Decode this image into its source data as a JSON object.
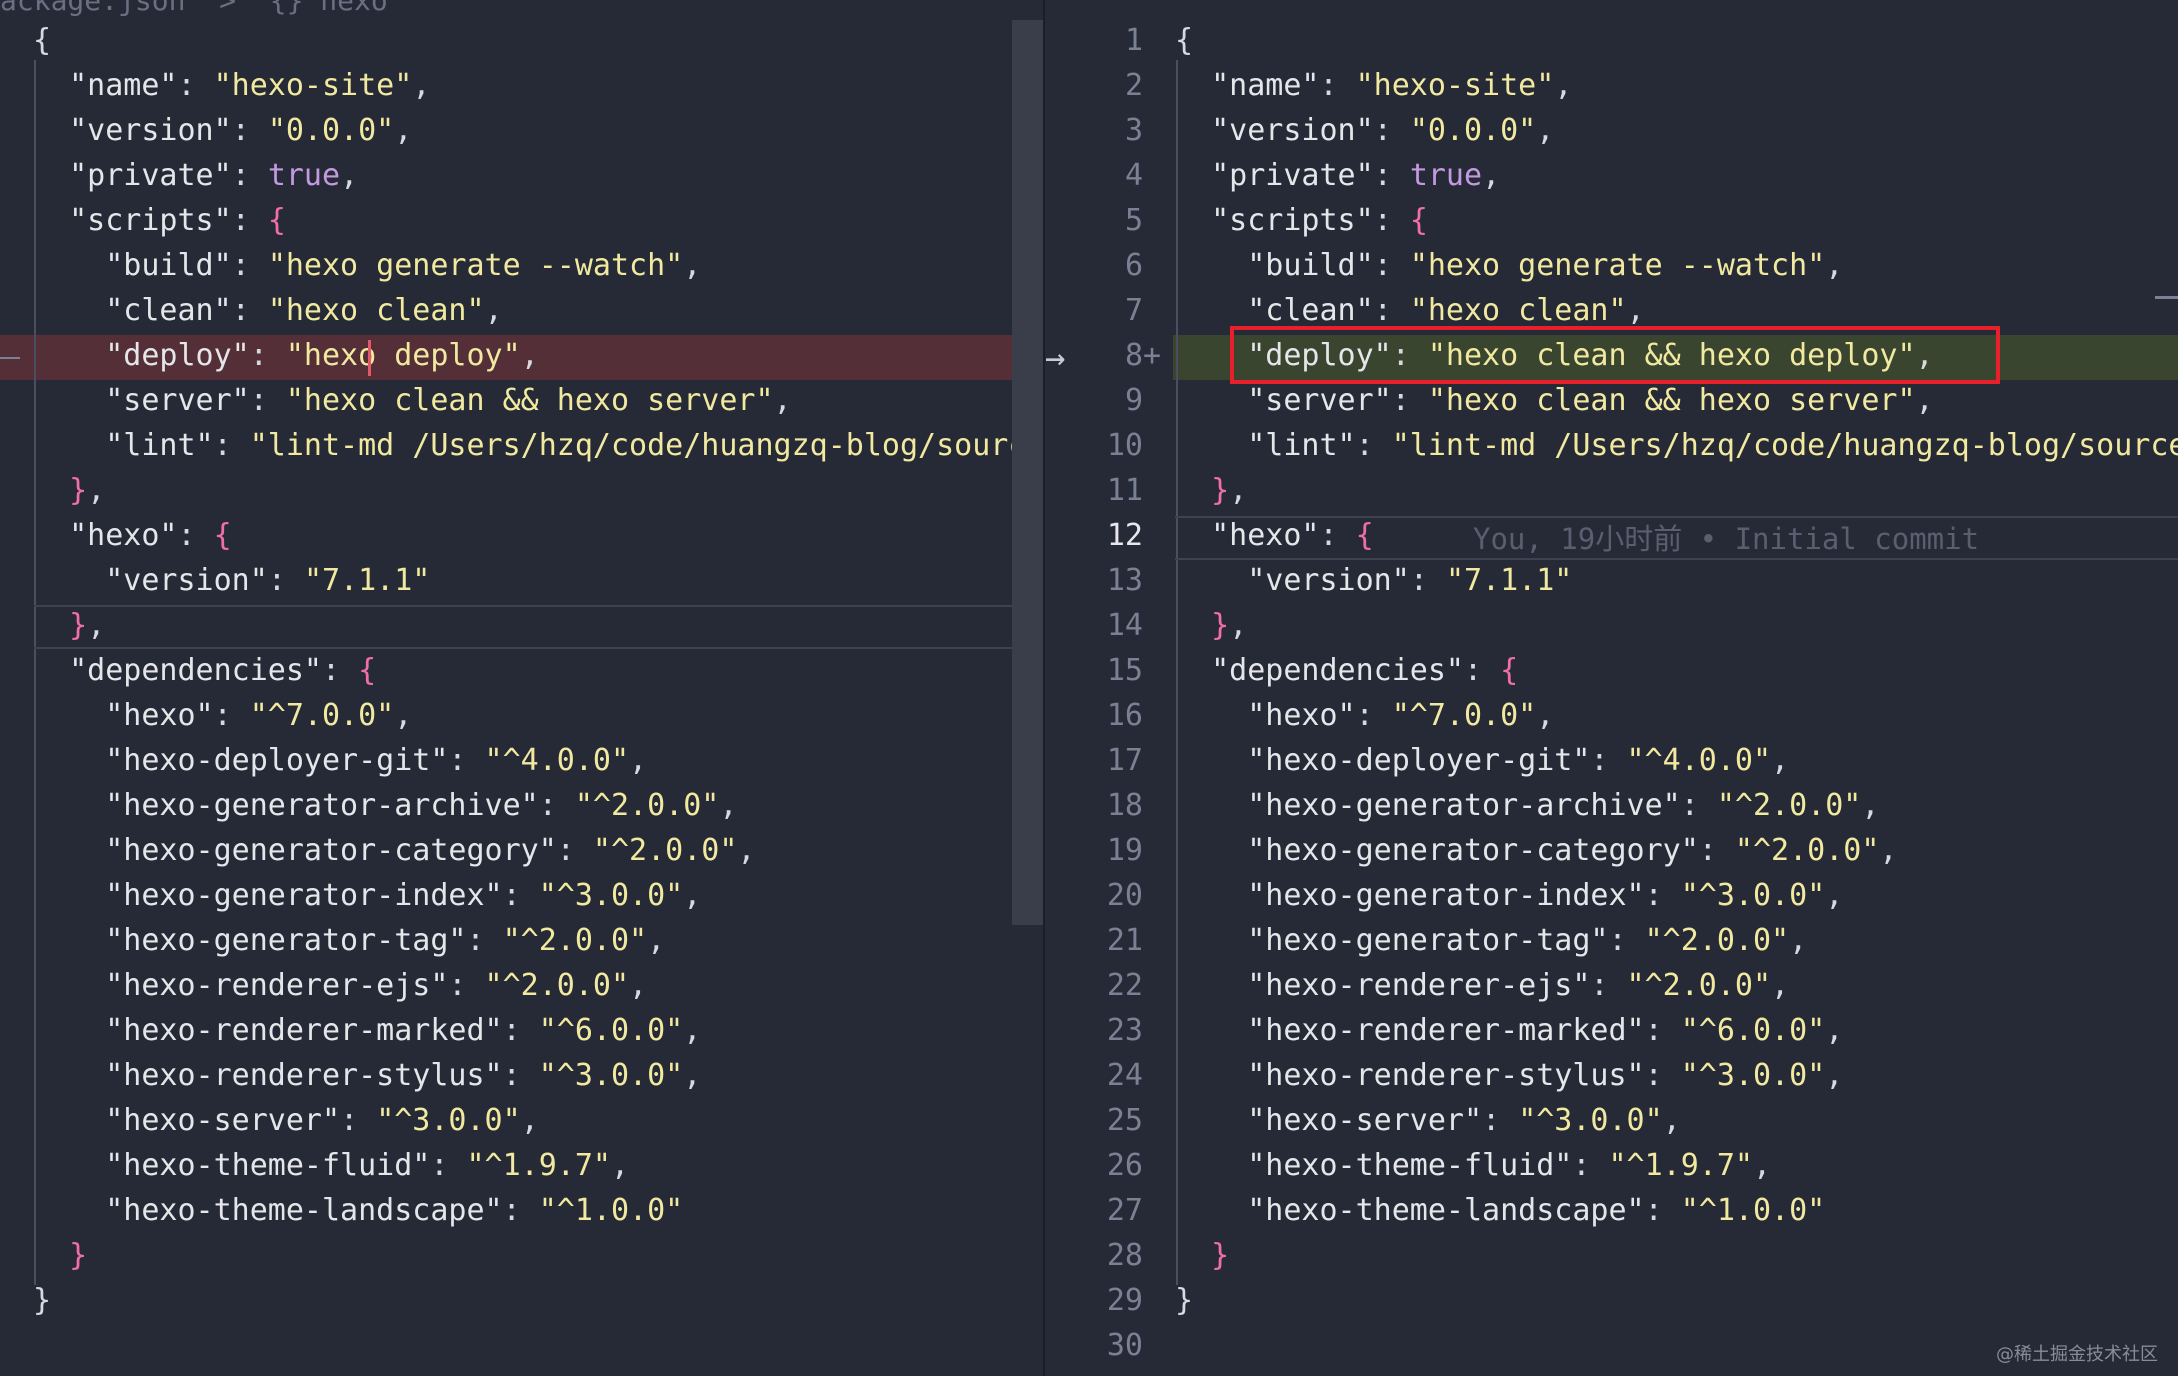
{
  "breadcrumb": "ackage.json  >  {} hexo",
  "left_lines": [
    [
      [
        "punc",
        "{"
      ]
    ],
    [
      [
        "punc",
        "  "
      ],
      [
        "k",
        "\"name\""
      ],
      [
        "punc",
        ": "
      ],
      [
        "s",
        "\"hexo-site\""
      ],
      [
        "punc",
        ","
      ]
    ],
    [
      [
        "punc",
        "  "
      ],
      [
        "k",
        "\"version\""
      ],
      [
        "punc",
        ": "
      ],
      [
        "s",
        "\"0.0.0\""
      ],
      [
        "punc",
        ","
      ]
    ],
    [
      [
        "punc",
        "  "
      ],
      [
        "k",
        "\"private\""
      ],
      [
        "punc",
        ": "
      ],
      [
        "b",
        "true"
      ],
      [
        "punc",
        ","
      ]
    ],
    [
      [
        "punc",
        "  "
      ],
      [
        "k",
        "\"scripts\""
      ],
      [
        "punc",
        ": "
      ],
      [
        "p",
        "{"
      ]
    ],
    [
      [
        "punc",
        "    "
      ],
      [
        "k",
        "\"build\""
      ],
      [
        "punc",
        ": "
      ],
      [
        "s",
        "\"hexo generate --watch\""
      ],
      [
        "punc",
        ","
      ]
    ],
    [
      [
        "punc",
        "    "
      ],
      [
        "k",
        "\"clean\""
      ],
      [
        "punc",
        ": "
      ],
      [
        "s",
        "\"hexo clean\""
      ],
      [
        "punc",
        ","
      ]
    ],
    [
      [
        "punc",
        "    "
      ],
      [
        "k",
        "\"deploy\""
      ],
      [
        "punc",
        ": "
      ],
      [
        "s",
        "\"hexo deploy\""
      ],
      [
        "punc",
        ","
      ]
    ],
    [
      [
        "punc",
        "    "
      ],
      [
        "k",
        "\"server\""
      ],
      [
        "punc",
        ": "
      ],
      [
        "s",
        "\"hexo clean && hexo server\""
      ],
      [
        "punc",
        ","
      ]
    ],
    [
      [
        "punc",
        "    "
      ],
      [
        "k",
        "\"lint\""
      ],
      [
        "punc",
        ": "
      ],
      [
        "s",
        "\"lint-md /Users/hzq/code/huangzq-blog/source/"
      ]
    ],
    [
      [
        "punc",
        "  "
      ],
      [
        "p",
        "}"
      ],
      [
        "punc",
        ","
      ]
    ],
    [
      [
        "punc",
        "  "
      ],
      [
        "k",
        "\"hexo\""
      ],
      [
        "punc",
        ": "
      ],
      [
        "p",
        "{"
      ]
    ],
    [
      [
        "punc",
        "    "
      ],
      [
        "k",
        "\"version\""
      ],
      [
        "punc",
        ": "
      ],
      [
        "s",
        "\"7.1.1\""
      ]
    ],
    [
      [
        "punc",
        "  "
      ],
      [
        "p",
        "}"
      ],
      [
        "punc",
        ","
      ]
    ],
    [
      [
        "punc",
        "  "
      ],
      [
        "k",
        "\"dependencies\""
      ],
      [
        "punc",
        ": "
      ],
      [
        "p",
        "{"
      ]
    ],
    [
      [
        "punc",
        "    "
      ],
      [
        "k",
        "\"hexo\""
      ],
      [
        "punc",
        ": "
      ],
      [
        "s",
        "\"^7.0.0\""
      ],
      [
        "punc",
        ","
      ]
    ],
    [
      [
        "punc",
        "    "
      ],
      [
        "k",
        "\"hexo-deployer-git\""
      ],
      [
        "punc",
        ": "
      ],
      [
        "s",
        "\"^4.0.0\""
      ],
      [
        "punc",
        ","
      ]
    ],
    [
      [
        "punc",
        "    "
      ],
      [
        "k",
        "\"hexo-generator-archive\""
      ],
      [
        "punc",
        ": "
      ],
      [
        "s",
        "\"^2.0.0\""
      ],
      [
        "punc",
        ","
      ]
    ],
    [
      [
        "punc",
        "    "
      ],
      [
        "k",
        "\"hexo-generator-category\""
      ],
      [
        "punc",
        ": "
      ],
      [
        "s",
        "\"^2.0.0\""
      ],
      [
        "punc",
        ","
      ]
    ],
    [
      [
        "punc",
        "    "
      ],
      [
        "k",
        "\"hexo-generator-index\""
      ],
      [
        "punc",
        ": "
      ],
      [
        "s",
        "\"^3.0.0\""
      ],
      [
        "punc",
        ","
      ]
    ],
    [
      [
        "punc",
        "    "
      ],
      [
        "k",
        "\"hexo-generator-tag\""
      ],
      [
        "punc",
        ": "
      ],
      [
        "s",
        "\"^2.0.0\""
      ],
      [
        "punc",
        ","
      ]
    ],
    [
      [
        "punc",
        "    "
      ],
      [
        "k",
        "\"hexo-renderer-ejs\""
      ],
      [
        "punc",
        ": "
      ],
      [
        "s",
        "\"^2.0.0\""
      ],
      [
        "punc",
        ","
      ]
    ],
    [
      [
        "punc",
        "    "
      ],
      [
        "k",
        "\"hexo-renderer-marked\""
      ],
      [
        "punc",
        ": "
      ],
      [
        "s",
        "\"^6.0.0\""
      ],
      [
        "punc",
        ","
      ]
    ],
    [
      [
        "punc",
        "    "
      ],
      [
        "k",
        "\"hexo-renderer-stylus\""
      ],
      [
        "punc",
        ": "
      ],
      [
        "s",
        "\"^3.0.0\""
      ],
      [
        "punc",
        ","
      ]
    ],
    [
      [
        "punc",
        "    "
      ],
      [
        "k",
        "\"hexo-server\""
      ],
      [
        "punc",
        ": "
      ],
      [
        "s",
        "\"^3.0.0\""
      ],
      [
        "punc",
        ","
      ]
    ],
    [
      [
        "punc",
        "    "
      ],
      [
        "k",
        "\"hexo-theme-fluid\""
      ],
      [
        "punc",
        ": "
      ],
      [
        "s",
        "\"^1.9.7\""
      ],
      [
        "punc",
        ","
      ]
    ],
    [
      [
        "punc",
        "    "
      ],
      [
        "k",
        "\"hexo-theme-landscape\""
      ],
      [
        "punc",
        ": "
      ],
      [
        "s",
        "\"^1.0.0\""
      ]
    ],
    [
      [
        "punc",
        "  "
      ],
      [
        "p",
        "}"
      ]
    ],
    [
      [
        "punc",
        "}"
      ]
    ]
  ],
  "right_lines": [
    [
      [
        "punc",
        "{"
      ]
    ],
    [
      [
        "punc",
        "  "
      ],
      [
        "k",
        "\"name\""
      ],
      [
        "punc",
        ": "
      ],
      [
        "s",
        "\"hexo-site\""
      ],
      [
        "punc",
        ","
      ]
    ],
    [
      [
        "punc",
        "  "
      ],
      [
        "k",
        "\"version\""
      ],
      [
        "punc",
        ": "
      ],
      [
        "s",
        "\"0.0.0\""
      ],
      [
        "punc",
        ","
      ]
    ],
    [
      [
        "punc",
        "  "
      ],
      [
        "k",
        "\"private\""
      ],
      [
        "punc",
        ": "
      ],
      [
        "b",
        "true"
      ],
      [
        "punc",
        ","
      ]
    ],
    [
      [
        "punc",
        "  "
      ],
      [
        "k",
        "\"scripts\""
      ],
      [
        "punc",
        ": "
      ],
      [
        "p",
        "{"
      ]
    ],
    [
      [
        "punc",
        "    "
      ],
      [
        "k",
        "\"build\""
      ],
      [
        "punc",
        ": "
      ],
      [
        "s",
        "\"hexo generate --watch\""
      ],
      [
        "punc",
        ","
      ]
    ],
    [
      [
        "punc",
        "    "
      ],
      [
        "k",
        "\"clean\""
      ],
      [
        "punc",
        ": "
      ],
      [
        "s",
        "\"hexo clean\""
      ],
      [
        "punc",
        ","
      ]
    ],
    [
      [
        "punc",
        "    "
      ],
      [
        "k",
        "\"deploy\""
      ],
      [
        "punc",
        ": "
      ],
      [
        "s",
        "\"hexo clean && hexo deploy\""
      ],
      [
        "punc",
        ","
      ]
    ],
    [
      [
        "punc",
        "    "
      ],
      [
        "k",
        "\"server\""
      ],
      [
        "punc",
        ": "
      ],
      [
        "s",
        "\"hexo clean && hexo server\""
      ],
      [
        "punc",
        ","
      ]
    ],
    [
      [
        "punc",
        "    "
      ],
      [
        "k",
        "\"lint\""
      ],
      [
        "punc",
        ": "
      ],
      [
        "s",
        "\"lint-md /Users/hzq/code/huangzq-blog/source/"
      ]
    ],
    [
      [
        "punc",
        "  "
      ],
      [
        "p",
        "}"
      ],
      [
        "punc",
        ","
      ]
    ],
    [
      [
        "punc",
        "  "
      ],
      [
        "k",
        "\"hexo\""
      ],
      [
        "punc",
        ": "
      ],
      [
        "p",
        "{"
      ]
    ],
    [
      [
        "punc",
        "    "
      ],
      [
        "k",
        "\"version\""
      ],
      [
        "punc",
        ": "
      ],
      [
        "s",
        "\"7.1.1\""
      ]
    ],
    [
      [
        "punc",
        "  "
      ],
      [
        "p",
        "}"
      ],
      [
        "punc",
        ","
      ]
    ],
    [
      [
        "punc",
        "  "
      ],
      [
        "k",
        "\"dependencies\""
      ],
      [
        "punc",
        ": "
      ],
      [
        "p",
        "{"
      ]
    ],
    [
      [
        "punc",
        "    "
      ],
      [
        "k",
        "\"hexo\""
      ],
      [
        "punc",
        ": "
      ],
      [
        "s",
        "\"^7.0.0\""
      ],
      [
        "punc",
        ","
      ]
    ],
    [
      [
        "punc",
        "    "
      ],
      [
        "k",
        "\"hexo-deployer-git\""
      ],
      [
        "punc",
        ": "
      ],
      [
        "s",
        "\"^4.0.0\""
      ],
      [
        "punc",
        ","
      ]
    ],
    [
      [
        "punc",
        "    "
      ],
      [
        "k",
        "\"hexo-generator-archive\""
      ],
      [
        "punc",
        ": "
      ],
      [
        "s",
        "\"^2.0.0\""
      ],
      [
        "punc",
        ","
      ]
    ],
    [
      [
        "punc",
        "    "
      ],
      [
        "k",
        "\"hexo-generator-category\""
      ],
      [
        "punc",
        ": "
      ],
      [
        "s",
        "\"^2.0.0\""
      ],
      [
        "punc",
        ","
      ]
    ],
    [
      [
        "punc",
        "    "
      ],
      [
        "k",
        "\"hexo-generator-index\""
      ],
      [
        "punc",
        ": "
      ],
      [
        "s",
        "\"^3.0.0\""
      ],
      [
        "punc",
        ","
      ]
    ],
    [
      [
        "punc",
        "    "
      ],
      [
        "k",
        "\"hexo-generator-tag\""
      ],
      [
        "punc",
        ": "
      ],
      [
        "s",
        "\"^2.0.0\""
      ],
      [
        "punc",
        ","
      ]
    ],
    [
      [
        "punc",
        "    "
      ],
      [
        "k",
        "\"hexo-renderer-ejs\""
      ],
      [
        "punc",
        ": "
      ],
      [
        "s",
        "\"^2.0.0\""
      ],
      [
        "punc",
        ","
      ]
    ],
    [
      [
        "punc",
        "    "
      ],
      [
        "k",
        "\"hexo-renderer-marked\""
      ],
      [
        "punc",
        ": "
      ],
      [
        "s",
        "\"^6.0.0\""
      ],
      [
        "punc",
        ","
      ]
    ],
    [
      [
        "punc",
        "    "
      ],
      [
        "k",
        "\"hexo-renderer-stylus\""
      ],
      [
        "punc",
        ": "
      ],
      [
        "s",
        "\"^3.0.0\""
      ],
      [
        "punc",
        ","
      ]
    ],
    [
      [
        "punc",
        "    "
      ],
      [
        "k",
        "\"hexo-server\""
      ],
      [
        "punc",
        ": "
      ],
      [
        "s",
        "\"^3.0.0\""
      ],
      [
        "punc",
        ","
      ]
    ],
    [
      [
        "punc",
        "    "
      ],
      [
        "k",
        "\"hexo-theme-fluid\""
      ],
      [
        "punc",
        ": "
      ],
      [
        "s",
        "\"^1.9.7\""
      ],
      [
        "punc",
        ","
      ]
    ],
    [
      [
        "punc",
        "    "
      ],
      [
        "k",
        "\"hexo-theme-landscape\""
      ],
      [
        "punc",
        ": "
      ],
      [
        "s",
        "\"^1.0.0\""
      ]
    ],
    [
      [
        "punc",
        "  "
      ],
      [
        "p",
        "}"
      ]
    ],
    [
      [
        "punc",
        "}"
      ]
    ],
    []
  ],
  "right_line_numbers": [
    "1",
    "2",
    "3",
    "4",
    "5",
    "6",
    "7",
    "8",
    "9",
    "10",
    "11",
    "12",
    "13",
    "14",
    "15",
    "16",
    "17",
    "18",
    "19",
    "20",
    "21",
    "22",
    "23",
    "24",
    "25",
    "26",
    "27",
    "28",
    "29",
    "30"
  ],
  "added_marker": "+",
  "arrow_icon": "→",
  "blame": "You, 19小时前 • Initial commit",
  "watermark": "@稀土掘金技术社区",
  "colors": {
    "background": "#262a36",
    "deleted_line": "#552f38",
    "added_line": "#3a4530",
    "highlight_box": "#e7202b"
  }
}
